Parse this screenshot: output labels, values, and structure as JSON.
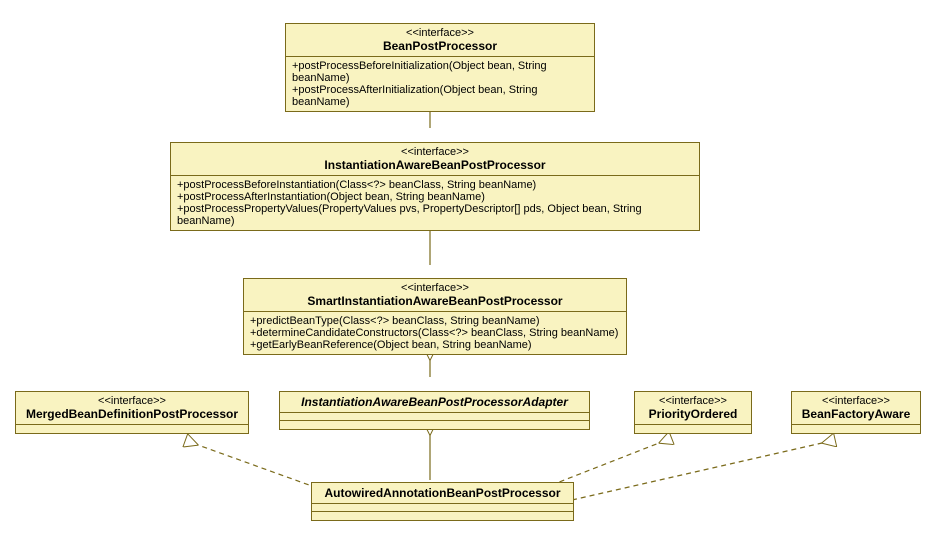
{
  "stereo": "<<interface>>",
  "boxes": {
    "bpp": {
      "name": "BeanPostProcessor",
      "ops": [
        "+postProcessBeforeInitialization(Object bean, String beanName)",
        "+postProcessAfterInitialization(Object bean, String beanName)"
      ]
    },
    "iabpp": {
      "name": "InstantiationAwareBeanPostProcessor",
      "ops": [
        "+postProcessBeforeInstantiation(Class<?> beanClass, String beanName)",
        "+postProcessAfterInstantiation(Object bean, String beanName)",
        "+postProcessPropertyValues(PropertyValues pvs, PropertyDescriptor[] pds, Object bean, String beanName)"
      ]
    },
    "siabpp": {
      "name": "SmartInstantiationAwareBeanPostProcessor",
      "ops": [
        "+predictBeanType(Class<?> beanClass, String beanName)",
        "+determineCandidateConstructors(Class<?> beanClass, String beanName)",
        "+getEarlyBeanReference(Object bean, String beanName)"
      ]
    },
    "adapter": {
      "name": "InstantiationAwareBeanPostProcessorAdapter"
    },
    "mbdpp": {
      "name": "MergedBeanDefinitionPostProcessor"
    },
    "po": {
      "name": "PriorityOrdered"
    },
    "bfa": {
      "name": "BeanFactoryAware"
    },
    "aabpp": {
      "name": "AutowiredAnnotationBeanPostProcessor"
    }
  }
}
